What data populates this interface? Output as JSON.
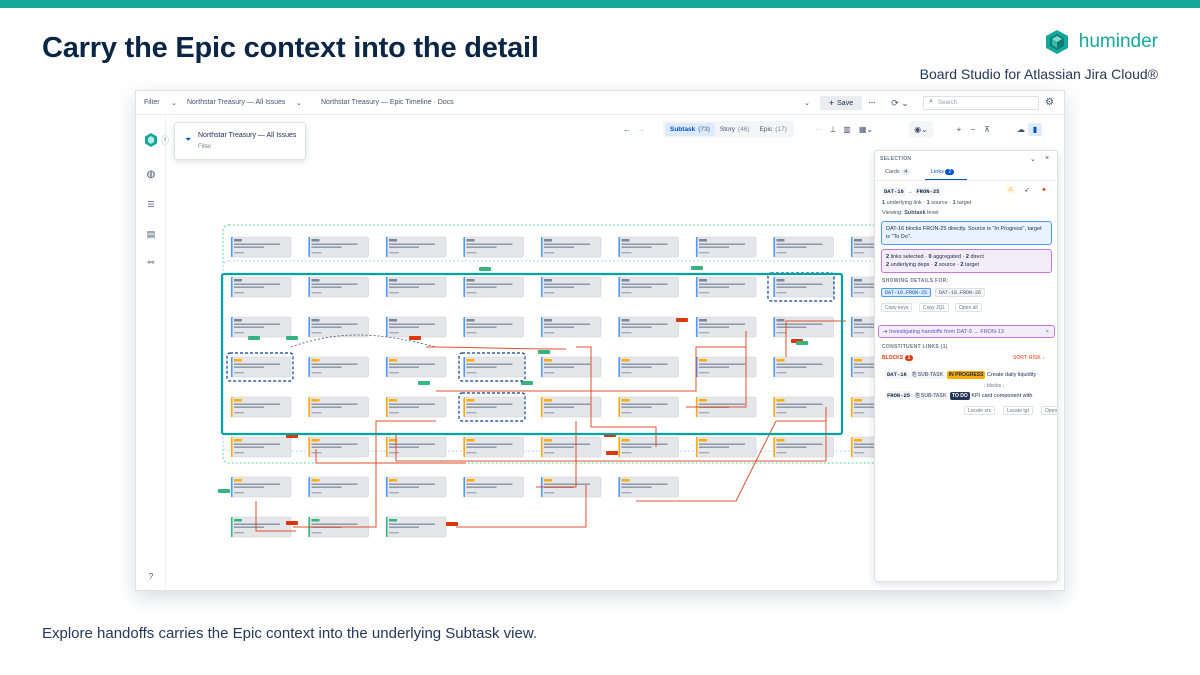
{
  "headline": "Carry the Epic context into the detail",
  "brand": {
    "name": "huminder",
    "subtitle": "Board Studio for Atlassian Jira Cloud®"
  },
  "caption": "Explore handoffs carries the Epic context into the underlying Subtask view.",
  "colors": {
    "accent": "#14a89a",
    "link": "#de350b",
    "highlight": "#00a3a3",
    "epic_tag": "#ffab00",
    "story_tag": "#36b37e"
  },
  "toolbar": {
    "filter_label": "Filter",
    "board_select": "Northstar Treasury — All Issues",
    "view_title": "Northstar Treasury — Epic Timeline · Docs",
    "save_label": "Save",
    "search_placeholder": "Search"
  },
  "filter_popover": {
    "name": "Northstar Treasury — All Issues",
    "sub": "Filter"
  },
  "levels": [
    {
      "label": "Subtask",
      "count": "(73)"
    },
    {
      "label": "Story",
      "count": "(46)"
    },
    {
      "label": "Epic",
      "count": "(17)"
    }
  ],
  "rail_icons": [
    "globe-icon",
    "list-icon",
    "board-icon",
    "link-icon",
    "help-icon"
  ],
  "panel": {
    "title": "SELECTION",
    "tabs": [
      {
        "label": "Cards",
        "count": "4"
      },
      {
        "label": "Links",
        "count": "2"
      }
    ],
    "link_from": "DAT-16",
    "link_arrow": "→",
    "link_to": "FRON-25",
    "link_summary_a": "1",
    "link_summary_b": "underlying link · ",
    "link_summary_c": "1",
    "link_summary_d": "source · ",
    "link_summary_e": "1",
    "link_summary_f": "target",
    "viewing_prefix": "Viewing:",
    "viewing_level": "Subtask",
    "viewing_suffix": "level",
    "info_note": "DAT-16 blocks FRON-25 directly. Source is \"In Progress\", target is \"To Do\".",
    "sel_line1_a": "2",
    "sel_line1_b": "links selected ·",
    "sel_line1_c": "0",
    "sel_line1_d": "aggregated ·",
    "sel_line1_e": "2",
    "sel_line1_f": "direct",
    "sel_line2_a": "2",
    "sel_line2_b": "underlying deps ·",
    "sel_line2_c": "2",
    "sel_line2_d": "source ·",
    "sel_line2_e": "2",
    "sel_line2_f": "target",
    "showing_label": "SHOWING DETAILS FOR:",
    "detail_chips": [
      "DAT-16→FRON-25",
      "DAT-18→FRON-26"
    ],
    "actions": [
      "Copy keys",
      "Copy JQL",
      "Open all"
    ],
    "investigating": "Investigating handoffs from DAT-9 → FRON-13",
    "constituent_label": "CONSTITUENT LINKS (1)",
    "group_label": "BLOCKS",
    "group_count": "1",
    "sort_label": "SORT: RISK ↓",
    "row1": {
      "key": "DAT-16",
      "type": "SUB-TASK",
      "status": "IN PROGRESS",
      "summary": "Create daily liquidity"
    },
    "blocks_label": "↓ blocks ↓",
    "row2": {
      "key": "FRON-25",
      "type": "SUB-TASK",
      "status": "TO DO",
      "summary": "KPI card component with"
    },
    "row_actions": [
      "Locate src",
      "Locate tgt",
      "Open"
    ]
  }
}
